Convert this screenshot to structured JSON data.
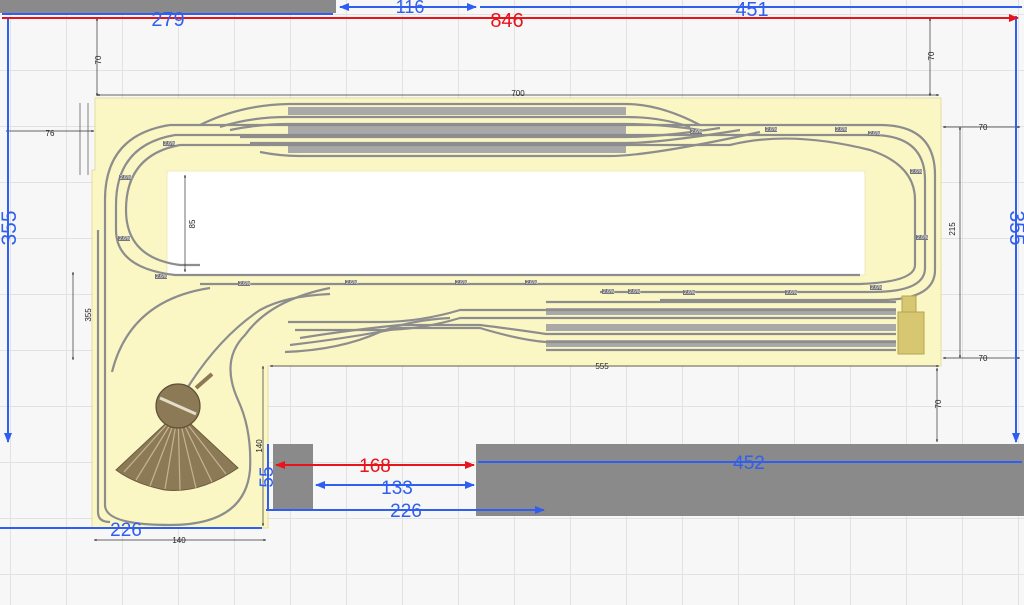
{
  "colors": {
    "board": "#fbf7c5",
    "wall": "#8a8a8a",
    "dim_blue": "#2f5ff0",
    "dim_red": "#e8141b",
    "track": "#8d8d8d",
    "platform": "#a9a9a9",
    "turntable": "#8c7a56"
  },
  "room": {
    "top_left_wall": "279",
    "top_door": "116",
    "top_right_wall": "451",
    "total_width": "846",
    "left_height": "355",
    "right_height": "355",
    "door_width": "168",
    "wall_block": "55",
    "bottom_left_wall": "226",
    "bottom_mid_wall": "133",
    "bottom_right_span": "226",
    "bottom_right_wall": "452"
  },
  "layout": {
    "top_margin_left": "70",
    "top_margin_right": "70",
    "board_width": "700",
    "left_margin": "76",
    "right_margin": "70",
    "inner_width": "85",
    "left_leg_height": "355",
    "right_end_height": "215",
    "right_end_margin": "70",
    "lower_width": "555",
    "lower_margin": "70",
    "bottom_leg_height": "140",
    "bottom_leg_width": "140"
  },
  "grades": [
    "2.6%",
    "2.6%",
    "2.6%",
    "2.6%",
    "2.6%",
    "2.6%",
    "2.6%",
    "2.6%",
    "2.6%",
    "2.6%",
    "2.6%",
    "2.6%",
    "2.6%",
    "2.6%",
    "2.6%",
    "2.6%",
    "2.6%",
    "2.6%",
    "2.6%"
  ]
}
